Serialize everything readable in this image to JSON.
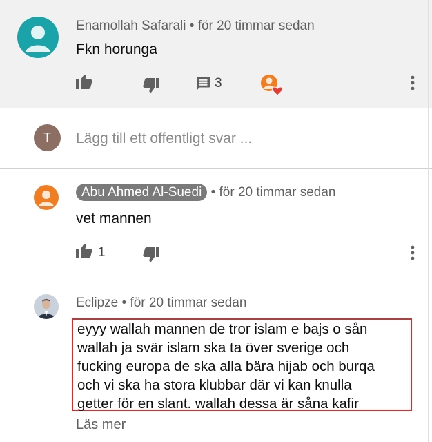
{
  "comments": [
    {
      "author": "Enamollah Safarali",
      "time": "• för 20 timmar sedan",
      "text": "Fkn horunga",
      "likes": "",
      "replies": "3",
      "avatar_color": "#1aa3a8"
    },
    {
      "author": "Abu Ahmed Al-Suedi",
      "time": "• för 20 timmar sedan",
      "text": "vet mannen",
      "likes": "1",
      "avatar_color": "#f07d22"
    },
    {
      "author": "Eclipze",
      "time": "• för 20 timmar sedan",
      "text_lines": [
        "eyyy wallah mannen de tror islam e bajs o sån",
        "wallah ja svär islam ska ta över sverige och",
        "fucking europa de ska alla bära hijab och burqa",
        "och vi ska ha stora klubbar där vi kan knulla",
        "getter för en slant. wallah dessa är såna kafir"
      ],
      "read_more": "Läs mer"
    }
  ],
  "reply": {
    "avatar_letter": "T",
    "avatar_color": "#8d6e63",
    "placeholder": "Lägg till ett offentligt svar ..."
  },
  "icons": {
    "like": "thumbs-up-icon",
    "dislike": "thumbs-down-icon",
    "replies": "comment-icon",
    "creator_heart": "creator-heart-icon",
    "menu": "more-vert-icon"
  },
  "colors": {
    "highlight_border": "#d32f2f",
    "heart": "#e53935"
  }
}
